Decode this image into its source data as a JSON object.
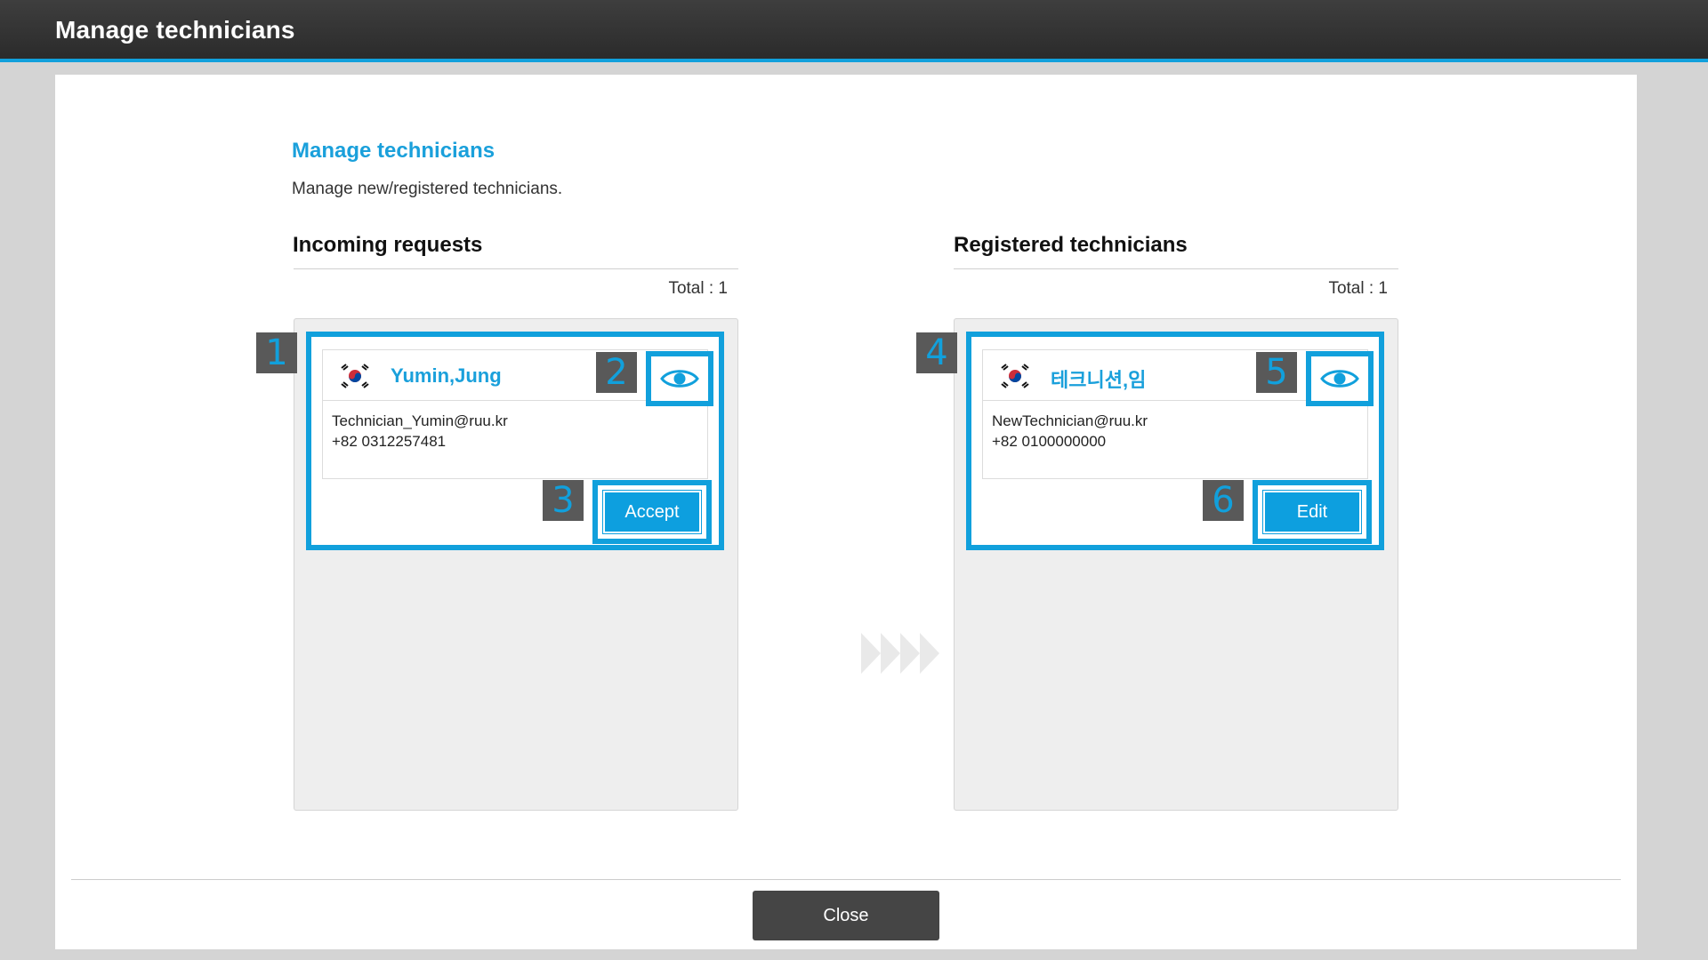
{
  "window": {
    "title": "Manage technicians"
  },
  "page": {
    "heading": "Manage technicians",
    "description": "Manage new/registered technicians."
  },
  "incoming": {
    "title": "Incoming requests",
    "total": "Total : 1",
    "card": {
      "name": "Yumin,Jung",
      "email": "Technician_Yumin@ruu.kr",
      "phone": "+82 0312257481",
      "action_label": "Accept"
    }
  },
  "registered": {
    "title": "Registered technicians",
    "total": "Total : 1",
    "card": {
      "name": "테크니션,임",
      "email": "NewTechnician@ruu.kr",
      "phone": "+82 0100000000",
      "action_label": "Edit"
    }
  },
  "badges": [
    "1",
    "2",
    "3",
    "4",
    "5",
    "6"
  ],
  "footer": {
    "close_label": "Close"
  },
  "icons": {
    "view": "eye-icon",
    "flag": "korea-flag-icon",
    "transfer": "arrows-right-icon"
  },
  "colors": {
    "accent": "#11a0dc",
    "topbar": "#333333",
    "badge": "#595959",
    "close_button": "#454545"
  }
}
